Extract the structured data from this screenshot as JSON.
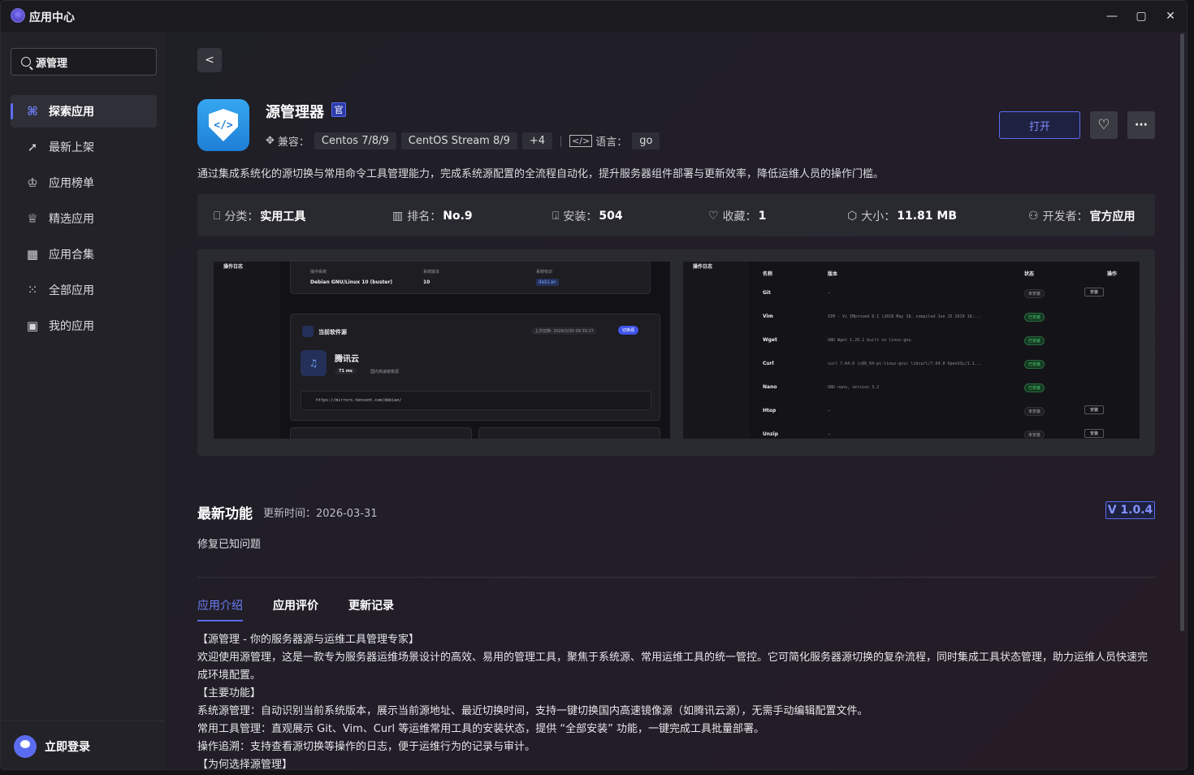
{
  "window": {
    "title": "应用中心",
    "minimize": "—",
    "maximize": "▢",
    "close": "✕"
  },
  "sidebar": {
    "search_value": "源管理",
    "items": [
      {
        "label": "探索应用",
        "icon": "explore-icon",
        "active": true
      },
      {
        "label": "最新上架",
        "icon": "rocket-icon"
      },
      {
        "label": "应用榜单",
        "icon": "trophy-icon"
      },
      {
        "label": "精选应用",
        "icon": "crown-icon"
      },
      {
        "label": "应用合集",
        "icon": "grid-icon"
      },
      {
        "label": "全部应用",
        "icon": "dots-grid-icon"
      },
      {
        "label": "我的应用",
        "icon": "app-box-icon"
      }
    ],
    "login_label": "立即登录"
  },
  "app": {
    "name": "源管理器",
    "official_badge": "官",
    "compat_label": "兼容：",
    "compat_tags": [
      "Centos 7/8/9",
      "CentOS Stream 8/9",
      "+4"
    ],
    "lang_label": "语言：",
    "lang_tag": "go",
    "open_button": "打开",
    "description": "通过集成系统化的源切换与常用命令工具管理能力，完成系统源配置的全流程自动化，提升服务器组件部署与更新效率，降低运维人员的操作门槛。"
  },
  "stats": [
    {
      "label": "分类：",
      "value": "实用工具",
      "icon": "bookmark-icon"
    },
    {
      "label": "排名：",
      "value": "No.9",
      "icon": "podium-icon"
    },
    {
      "label": "安装：",
      "value": "504",
      "icon": "download-icon"
    },
    {
      "label": "收藏：",
      "value": "1",
      "icon": "heart-icon"
    },
    {
      "label": "大小：",
      "value": "11.81 MB",
      "icon": "package-icon"
    },
    {
      "label": "开发者：",
      "value": "官方应用",
      "icon": "user-icon"
    }
  ],
  "screenshot1": {
    "sidebar_title": "操作日志",
    "os_label": "操作系统",
    "os_value": "Debian GNU/Linux 10 (buster)",
    "ver_label": "系统版本",
    "ver_value": "10",
    "id_label": "系统标识",
    "id_value": "debian",
    "current_title": "当前软件源",
    "last_switch": "上次切换: 2026/3/30 09:30:27",
    "switch_btn": "切换源",
    "mirror_name": "腾讯云",
    "latency": "71 ms",
    "mirror_desc": "国内高速镜像源",
    "mirror_url": "https://mirrors.tencent.com/debian/"
  },
  "screenshot2": {
    "sidebar_title": "操作日志",
    "headers": [
      "名称",
      "版本",
      "状态",
      "操作"
    ],
    "rows": [
      {
        "name": "Git",
        "version": "—",
        "status": "未安装",
        "action": "安装"
      },
      {
        "name": "Vim",
        "version": "VIM - Vi IMproved 8.1 (2018 May 18, compiled Jun 15 2019 16:...",
        "status": "已安装",
        "action": ""
      },
      {
        "name": "Wget",
        "version": "GNU Wget 1.20.1 built on linux-gnu.",
        "status": "已安装",
        "action": ""
      },
      {
        "name": "Curl",
        "version": "curl 7.64.0 (x86_64-pc-linux-gnu) libcurl/7.64.0 OpenSSL/1.1...",
        "status": "已安装",
        "action": ""
      },
      {
        "name": "Nano",
        "version": "GNU nano, version 3.2",
        "status": "已安装",
        "action": ""
      },
      {
        "name": "Htop",
        "version": "—",
        "status": "未安装",
        "action": "安装"
      },
      {
        "name": "Unzip",
        "version": "—",
        "status": "未安装",
        "action": "安装"
      }
    ]
  },
  "features": {
    "title": "最新功能",
    "update_time": "更新时间：2026-03-31",
    "version": "V 1.0.4",
    "body": "修复已知问题"
  },
  "tabs": [
    "应用介绍",
    "应用评价",
    "更新记录"
  ],
  "intro": [
    "【源管理 - 你的服务器源与运维工具管理专家】",
    "欢迎使用源管理，这是一款专为服务器运维场景设计的高效、易用的管理工具，聚焦于系统源、常用运维工具的统一管控。它可简化服务器源切换的复杂流程，同时集成工具状态管理，助力运维人员快速完成环境配置。",
    "【主要功能】",
    "系统源管理：自动识别当前系统版本，展示当前源地址、最近切换时间，支持一键切换国内高速镜像源（如腾讯云源），无需手动编辑配置文件。",
    "常用工具管理：直观展示 Git、Vim、Curl 等运维常用工具的安装状态，提供 “全部安装” 功能，一键完成工具批量部署。",
    "操作追溯：支持查看源切换等操作的日志，便于运维行为的记录与审计。",
    "【为何选择源管理】"
  ]
}
